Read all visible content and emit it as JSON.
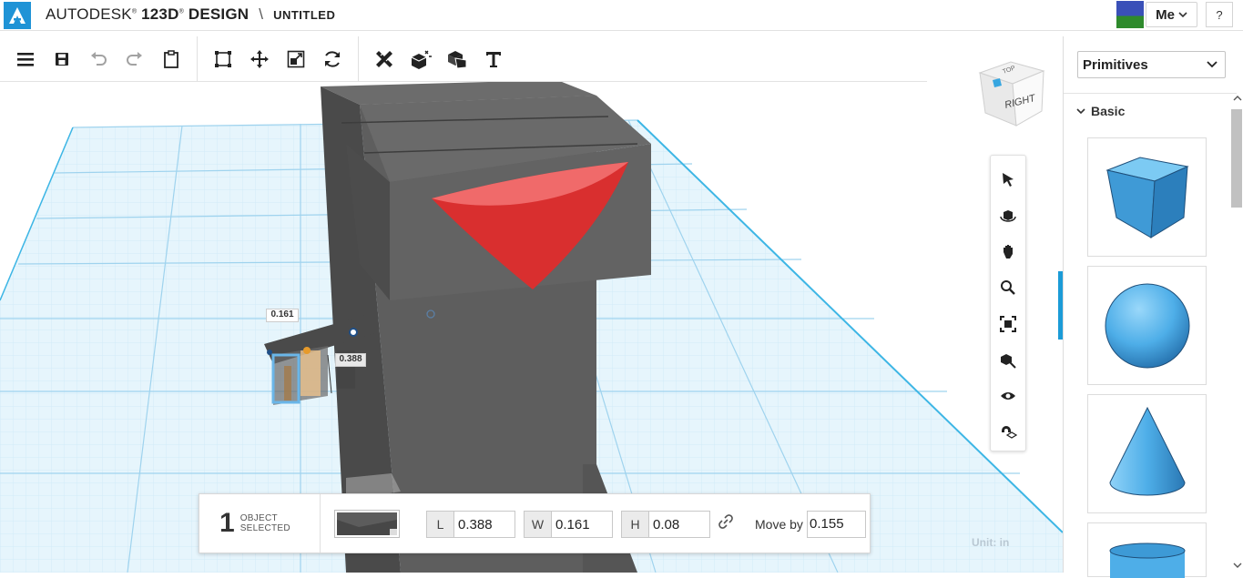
{
  "app": {
    "brand": "AUTODESK",
    "product": "123D",
    "product_suffix": "DESIGN",
    "separator": "\\",
    "document_name": "UNTITLED"
  },
  "header": {
    "user_label": "Me",
    "help_label": "?"
  },
  "toolbar": {
    "groups": [
      [
        "menu-icon",
        "save-icon",
        "undo-icon",
        "redo-icon",
        "clipboard-icon"
      ],
      [
        "transform-box-icon",
        "move-icon",
        "scale-icon",
        "refresh-icon"
      ],
      [
        "construct-icon",
        "modify-icon",
        "combine-icon",
        "text-icon"
      ]
    ]
  },
  "viewcube": {
    "face_label": "RIGHT"
  },
  "viewport": {
    "dimension_width": "0.161",
    "dimension_length": "0.388",
    "unit_label": "Unit:  in"
  },
  "navigation": [
    "select-icon",
    "orbit-icon",
    "pan-icon",
    "zoom-icon",
    "fit-icon",
    "zoom-selected-icon",
    "visibility-icon",
    "snap-icon"
  ],
  "selection": {
    "count": "1",
    "label_line1": "OBJECT",
    "label_line2": "SELECTED",
    "length_key": "L",
    "length_value": "0.388",
    "width_key": "W",
    "width_value": "0.161",
    "height_key": "H",
    "height_value": "0.08",
    "move_by_label": "Move by",
    "move_by_value": "0.155"
  },
  "sidebar": {
    "library_select": "Primitives",
    "section": "Basic",
    "items": [
      "box-primitive",
      "sphere-primitive",
      "cone-primitive",
      "cylinder-primitive"
    ]
  },
  "colors": {
    "accent": "#1b9bd7",
    "primitive": "#4eaee8",
    "model_body": "#5d5d5d",
    "cone_red": "#e23a3a",
    "grid": "#bde2f4"
  }
}
